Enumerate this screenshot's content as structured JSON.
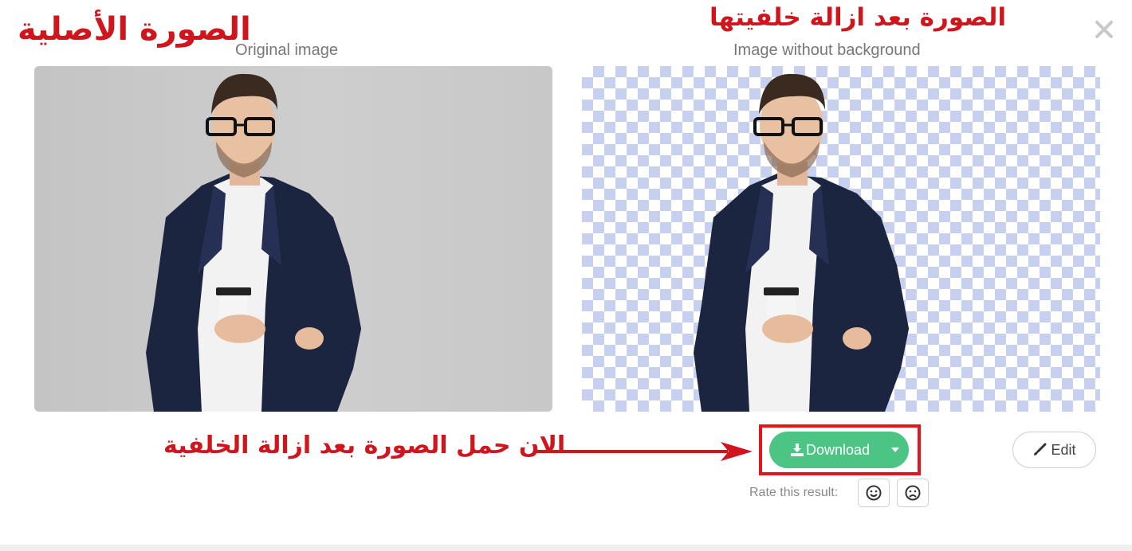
{
  "annotations": {
    "original_ar": "الصورة الأصلية",
    "removed_ar": "الصورة بعد ازالة خلفيتها",
    "download_ar": "الان حمل الصورة بعد ازالة الخلفية"
  },
  "original": {
    "heading": "Original image"
  },
  "result": {
    "heading": "Image without background"
  },
  "actions": {
    "download_label": "Download",
    "edit_label": "Edit"
  },
  "rating": {
    "label": "Rate this result:"
  },
  "colors": {
    "accent_green": "#4cc483",
    "annotation_red": "#d0161c",
    "checker_blue": "#c7d0ee"
  },
  "icons": {
    "close": "close-icon",
    "download": "download-icon",
    "caret": "caret-down-icon",
    "edit": "brush-icon",
    "happy": "smile-icon",
    "sad": "frown-icon",
    "arrow": "arrow-right-icon"
  }
}
